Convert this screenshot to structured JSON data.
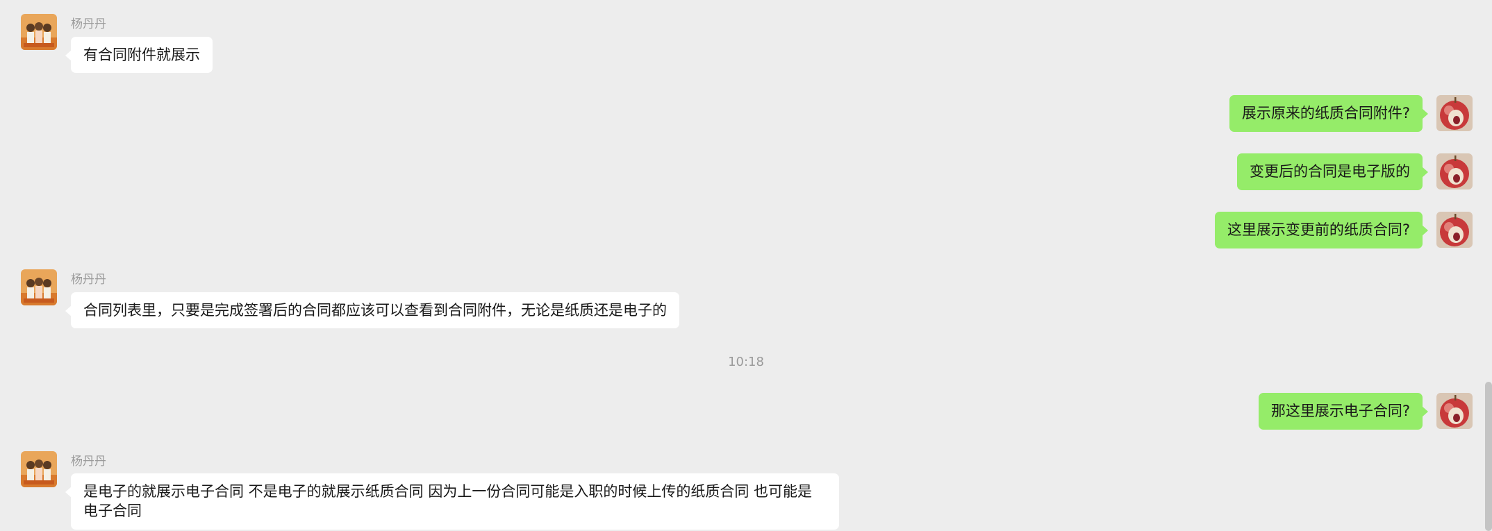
{
  "conversation": {
    "messages": [
      {
        "sender": "杨丹丹",
        "text": "有合同附件就展示"
      },
      {
        "text": "展示原来的纸质合同附件?"
      },
      {
        "text": "变更后的合同是电子版的"
      },
      {
        "text": "这里展示变更前的纸质合同?"
      },
      {
        "sender": "杨丹丹",
        "text": "合同列表里，只要是完成签署后的合同都应该可以查看到合同附件，无论是纸质还是电子的"
      },
      {
        "timestamp": "10:18"
      },
      {
        "text": "那这里展示电子合同?"
      },
      {
        "sender": "杨丹丹",
        "text": "是电子的就展示电子合同 不是电子的就展示纸质合同 因为上一份合同可能是入职的时候上传的纸质合同 也可能是电子合同"
      }
    ]
  },
  "colors": {
    "background": "#ededed",
    "incoming_bubble": "#ffffff",
    "outgoing_bubble": "#95ec69",
    "sender_name": "#9a9a9a",
    "text": "#191919"
  },
  "icons": {
    "incoming_avatar": "group-photo-avatar",
    "outgoing_avatar": "red-apple-avatar"
  }
}
